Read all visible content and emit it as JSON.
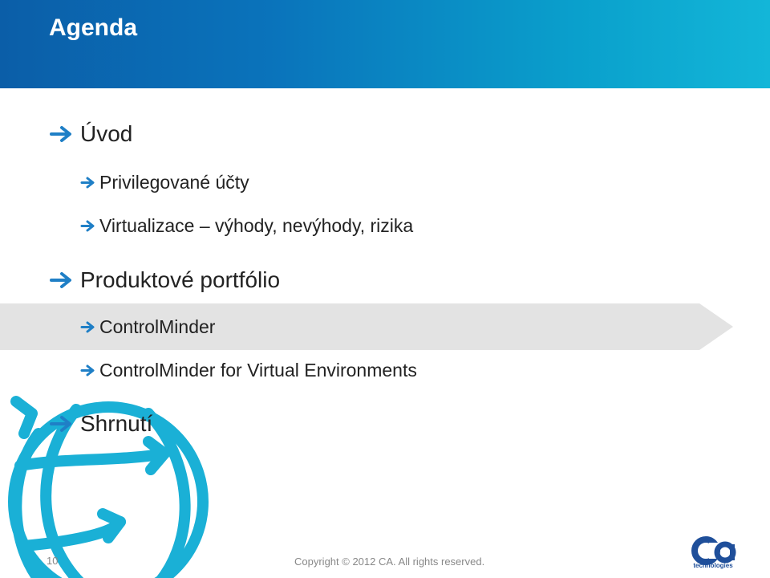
{
  "slide": {
    "title": "Agenda",
    "page_number": "10",
    "copyright": "Copyright © 2012 CA. All rights reserved.",
    "logo": {
      "mark": "ca",
      "subtitle": "technologies"
    },
    "colors": {
      "header_start": "#0b5ea8",
      "header_end": "#13b6d8",
      "arrow": "#1f7fc6",
      "globe": "#1ab0d6",
      "highlight": "#e3e3e3",
      "text": "#222222"
    },
    "items": [
      {
        "level": 1,
        "text": "Úvod"
      },
      {
        "level": 2,
        "text": "Privilegované účty"
      },
      {
        "level": 2,
        "text": "Virtualizace – výhody, nevýhody, rizika"
      },
      {
        "level": 1,
        "text": "Produktové portfólio"
      },
      {
        "level": 2,
        "text": "ControlMinder",
        "highlighted": true
      },
      {
        "level": 2,
        "text": "ControlMinder for Virtual Environments"
      },
      {
        "level": 1,
        "text": "Shrnutí"
      }
    ]
  }
}
